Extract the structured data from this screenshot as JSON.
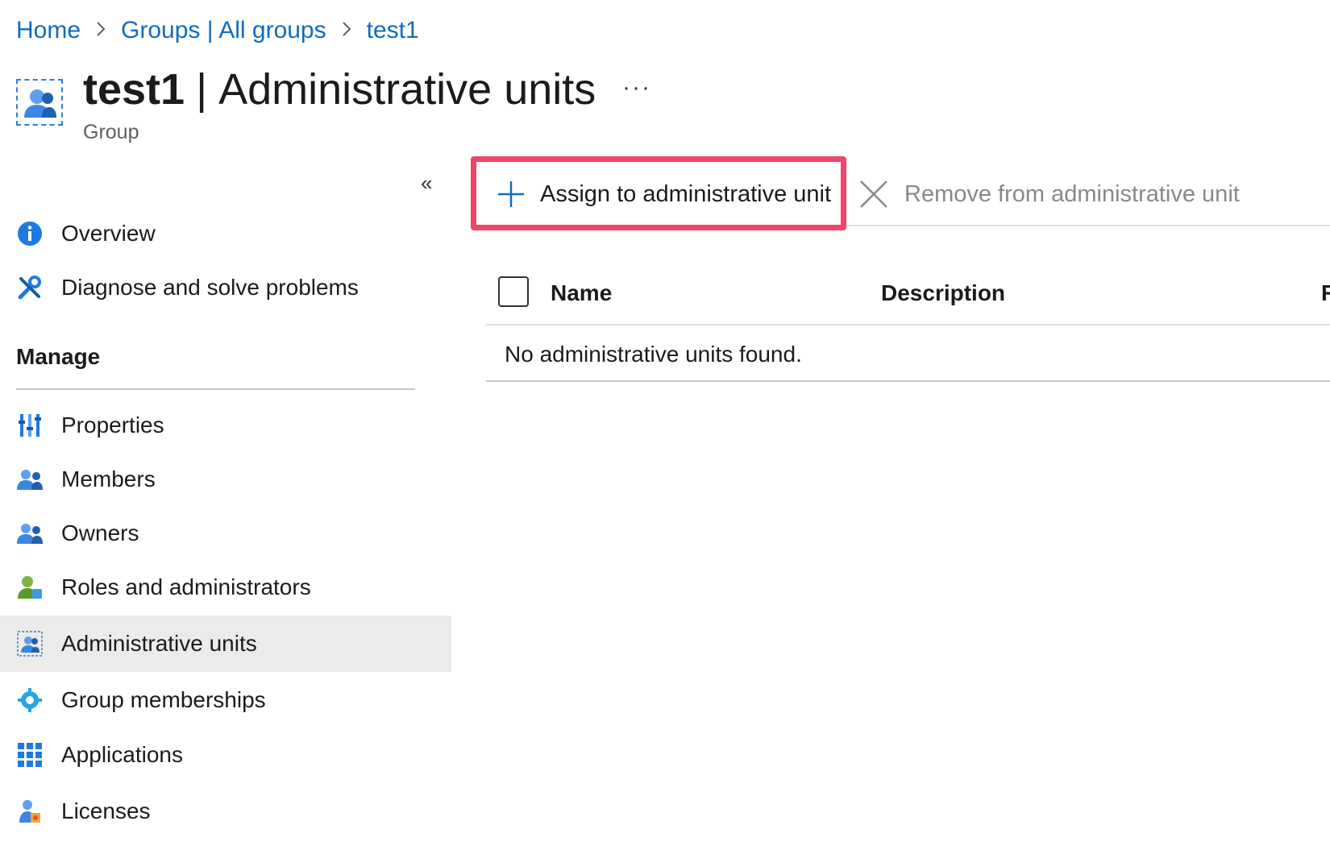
{
  "breadcrumb": {
    "items": [
      "Home",
      "Groups | All groups",
      "test1"
    ],
    "separator": ">"
  },
  "header": {
    "title_bold": "test1",
    "title_sep": "|",
    "title_rest": "Administrative units",
    "more": "···",
    "subtitle": "Group"
  },
  "sidebar": {
    "collapse": "«",
    "top_items": [
      {
        "label": "Overview",
        "icon": "info-icon"
      },
      {
        "label": "Diagnose and solve problems",
        "icon": "wrench-icon"
      }
    ],
    "manage_heading": "Manage",
    "items": [
      {
        "label": "Properties",
        "icon": "properties-icon"
      },
      {
        "label": "Members",
        "icon": "users-icon"
      },
      {
        "label": "Owners",
        "icon": "users-icon"
      },
      {
        "label": "Roles and administrators",
        "icon": "role-icon"
      },
      {
        "label": "Administrative units",
        "icon": "admin-unit-icon",
        "selected": true
      },
      {
        "label": "Group memberships",
        "icon": "gear-icon"
      },
      {
        "label": "Applications",
        "icon": "apps-grid-icon"
      },
      {
        "label": "Licenses",
        "icon": "license-icon"
      }
    ]
  },
  "toolbar": {
    "assign_label": "Assign to administrative unit",
    "remove_label": "Remove from administrative unit"
  },
  "table": {
    "columns": [
      "Name",
      "Description",
      "R"
    ],
    "empty_message": "No administrative units found."
  },
  "colors": {
    "link": "#0f6cbd",
    "highlight": "#f0446a",
    "selected_bg": "#edebe9"
  }
}
